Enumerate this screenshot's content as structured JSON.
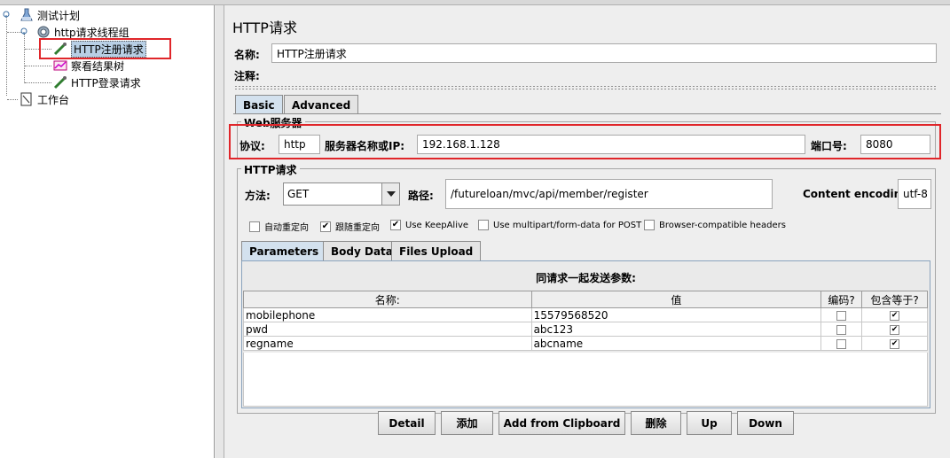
{
  "tree": {
    "items": [
      {
        "label": "测试计划",
        "icon": "test-plan-icon"
      },
      {
        "label": "http请求线程组",
        "icon": "thread-group-icon"
      },
      {
        "label": "HTTP注册请求",
        "icon": "sampler-icon",
        "selected": true
      },
      {
        "label": "察看结果树",
        "icon": "listener-icon"
      },
      {
        "label": "HTTP登录请求",
        "icon": "sampler-icon"
      },
      {
        "label": "工作台",
        "icon": "workbench-icon"
      }
    ]
  },
  "panel": {
    "title": "HTTP请求",
    "name_label": "名称:",
    "name_value": "HTTP注册请求",
    "comment_label": "注释:",
    "comment_value": ""
  },
  "tabs": {
    "basic": "Basic",
    "advanced": "Advanced"
  },
  "web_server": {
    "title": "Web服务器",
    "protocol_label": "协议:",
    "protocol_value": "http",
    "server_label": "服务器名称或IP:",
    "server_value": "192.168.1.128",
    "port_label": "端口号:",
    "port_value": "8080"
  },
  "http_request": {
    "title": "HTTP请求",
    "method_label": "方法:",
    "method_value": "GET",
    "path_label": "路径:",
    "path_value": "/futureloan/mvc/api/member/register",
    "encoding_label": "Content encoding:",
    "encoding_value": "utf-8"
  },
  "options": [
    {
      "label": "自动重定向",
      "checked": false
    },
    {
      "label": "跟随重定向",
      "checked": true
    },
    {
      "label": "Use KeepAlive",
      "checked": true
    },
    {
      "label": "Use multipart/form-data for POST",
      "checked": false
    },
    {
      "label": "Browser-compatible headers",
      "checked": false
    }
  ],
  "sub_tabs": {
    "parameters": "Parameters",
    "body_data": "Body Data",
    "files_upload": "Files Upload"
  },
  "params": {
    "caption": "同请求一起发送参数:",
    "columns": [
      "名称:",
      "值",
      "编码?",
      "包含等于?"
    ],
    "rows": [
      {
        "name": "mobilephone",
        "value": "15579568520",
        "encode": false,
        "include_equals": true
      },
      {
        "name": "pwd",
        "value": "abc123",
        "encode": false,
        "include_equals": true
      },
      {
        "name": "regname",
        "value": "abcname",
        "encode": false,
        "include_equals": true
      }
    ]
  },
  "buttons": {
    "detail": "Detail",
    "add": "添加",
    "add_clipboard": "Add from Clipboard",
    "delete": "删除",
    "up": "Up",
    "down": "Down"
  },
  "colors": {
    "highlight_red": "#e0262a",
    "tree_selection": "#b8cfe5",
    "active_tab": "#d3e1ee"
  }
}
